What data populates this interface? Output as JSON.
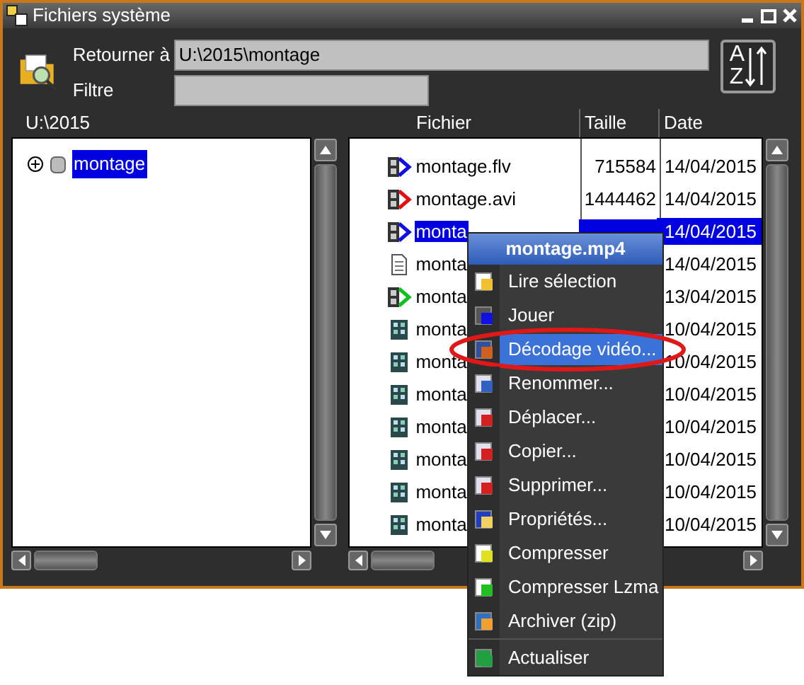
{
  "window": {
    "title": "Fichiers système"
  },
  "header": {
    "back_label": "Retourner à",
    "back_value": "U:\\2015\\montage",
    "filter_label": "Filtre",
    "sort_top": "A",
    "sort_bottom": "Z"
  },
  "tree": {
    "path": "U:\\2015",
    "items": [
      {
        "label": "montage",
        "selected": true,
        "expanded": false
      }
    ]
  },
  "files": {
    "columns": [
      "Fichier",
      "Taille",
      "Date"
    ],
    "rows": [
      {
        "kind": "video",
        "color": "#1010e0",
        "name": "montage.flv",
        "size": "715584",
        "date": "14/04/2015",
        "selected": false
      },
      {
        "kind": "video",
        "color": "#e01010",
        "name": "montage.avi",
        "size": "1444462",
        "date": "14/04/2015",
        "selected": false
      },
      {
        "kind": "video",
        "color": "#1010e0",
        "name": "monta",
        "date": "14/04/2015",
        "selected": true
      },
      {
        "kind": "document",
        "name": "monta",
        "date": "14/04/2015",
        "selected": false
      },
      {
        "kind": "video",
        "color": "#10c020",
        "name": "monta",
        "date": "13/04/2015",
        "selected": false
      },
      {
        "kind": "image",
        "name": "monta",
        "date": "10/04/2015",
        "selected": false
      },
      {
        "kind": "image",
        "name": "monta",
        "date": "10/04/2015",
        "selected": false
      },
      {
        "kind": "image",
        "name": "monta",
        "date": "10/04/2015",
        "selected": false
      },
      {
        "kind": "image",
        "name": "monta",
        "date": "10/04/2015",
        "selected": false
      },
      {
        "kind": "image",
        "name": "monta",
        "date": "10/04/2015",
        "selected": false
      },
      {
        "kind": "image",
        "name": "monta",
        "date": "10/04/2015",
        "selected": false
      },
      {
        "kind": "image",
        "name": "monta",
        "date": "10/04/2015",
        "selected": false
      }
    ]
  },
  "context_menu": {
    "title": "montage.mp4",
    "items": [
      {
        "label": "Lire sélection",
        "selected": false,
        "circled": false
      },
      {
        "label": "Jouer",
        "selected": false,
        "circled": false
      },
      {
        "label": "Décodage vidéo...",
        "selected": true,
        "circled": true
      },
      {
        "label": "Renommer...",
        "selected": false,
        "circled": false
      },
      {
        "label": "Déplacer...",
        "selected": false,
        "circled": false
      },
      {
        "label": "Copier...",
        "selected": false,
        "circled": false
      },
      {
        "label": "Supprimer...",
        "selected": false,
        "circled": false
      },
      {
        "label": "Propriétés...",
        "selected": false,
        "circled": false
      },
      {
        "label": "Compresser",
        "selected": false,
        "circled": false
      },
      {
        "label": "Compresser Lzma",
        "selected": false,
        "circled": false
      },
      {
        "label": "Archiver (zip)",
        "selected": false,
        "circled": false
      },
      {
        "label": "Actualiser",
        "selected": false,
        "circled": false
      }
    ]
  }
}
